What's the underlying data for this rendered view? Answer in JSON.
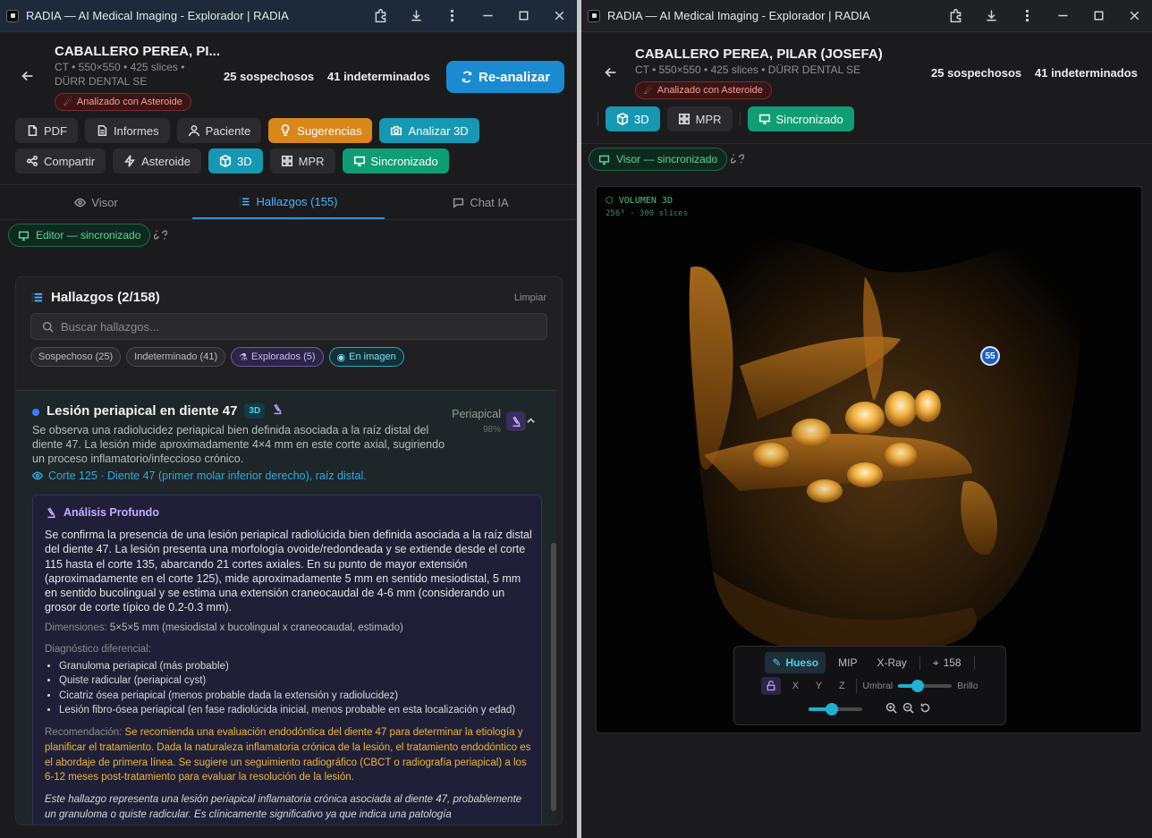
{
  "left": {
    "window_title": "RADIA — AI Medical Imaging - Explorador | RADIA",
    "patient": {
      "name": "CABALLERO PEREA, PI...",
      "meta_line1": "CT • 550×550 • 425 slices •",
      "meta_line2": "DÜRR DENTAL SE",
      "badge": "Analizado con Asteroide"
    },
    "stats": {
      "suspicious": "25 sospechosos",
      "indeterminate": "41 indeterminados"
    },
    "reanalyze": "Re-analizar",
    "toolbar1": [
      "PDF",
      "Informes",
      "Paciente",
      "Sugerencias",
      "Analizar 3D"
    ],
    "toolbar2": [
      "Compartir",
      "Asteroide",
      "3D",
      "MPR",
      "Sincronizado"
    ],
    "tabs": [
      "Visor",
      "Hallazgos (155)",
      "Chat IA"
    ],
    "sync": "Editor — sincronizado",
    "panel": {
      "title": "Hallazgos (2/158)",
      "clear": "Limpiar",
      "search_placeholder": "Buscar hallazgos...",
      "chips": [
        "Sospechoso (25)",
        "Indeterminado (41)",
        "Explorados (5)",
        "En imagen"
      ]
    },
    "finding": {
      "title": "Lesión periapical en diente 47",
      "tag": "3D",
      "type": "Periapical",
      "confidence": "98%",
      "description": "Se observa una radiolucidez periapical bien definida asociada a la raíz distal del diente 47. La lesión mide aproximadamente 4×4 mm en este corte axial, sugiriendo un proceso inflamatorio/infeccioso crónico.",
      "slice": "Corte 125 · Diente 47 (primer molar inferior derecho), raíz distal.",
      "deep": {
        "heading": "Análisis Profundo",
        "body": "Se confirma la presencia de una lesión periapical radiolúcida bien definida asociada a la raíz distal del diente 47. La lesión presenta una morfología ovoide/redondeada y se extiende desde el corte 115 hasta el corte 135, abarcando 21 cortes axiales. En su punto de mayor extensión (aproximadamente en el corte 125), mide aproximadamente 5 mm en sentido mesiodistal, 5 mm en sentido bucolingual y se estima una extensión craneocaudal de 4-6 mm (considerando un grosor de corte típico de 0.2-0.3 mm).",
        "dim_label": "Dimensiones:",
        "dim_value": "5×5×5 mm (mesiodistal x bucolingual x craneocaudal, estimado)",
        "diff_label": "Diagnóstico diferencial:",
        "diff": [
          "Granuloma periapical (más probable)",
          "Quiste radicular (periapical cyst)",
          "Cicatriz ósea periapical (menos probable dada la extensión y radiolucidez)",
          "Lesión fibro-ósea periapical (en fase radiolúcida inicial, menos probable en esta localización y edad)"
        ],
        "rec_label": "Recomendación:",
        "rec": "Se recomienda una evaluación endodóntica del diente 47 para determinar la etiología y planificar el tratamiento. Dada la naturaleza inflamatoria crónica de la lesión, el tratamiento endodóntico es el abordaje de primera línea. Se sugiere un seguimiento radiográfico (CBCT o radiografía periapical) a los 6-12 meses post-tratamiento para evaluar la resolución de la lesión.",
        "summary": "Este hallazgo representa una lesión periapical inflamatoria crónica asociada al diente 47, probablemente un granuloma o quiste radicular. Es clínicamente significativo ya que indica una patología"
      }
    }
  },
  "right": {
    "window_title": "RADIA — AI Medical Imaging - Explorador | RADIA",
    "patient": {
      "name": "CABALLERO PEREA, PILAR (JOSEFA)",
      "meta": "CT • 550×550 • 425 slices • DÜRR DENTAL SE",
      "badge": "Analizado con Asteroide"
    },
    "stats": {
      "suspicious": "25 sospechosos",
      "indeterminate": "41 indeterminados"
    },
    "toolbar": [
      "3D",
      "MPR",
      "Sincronizado"
    ],
    "sync": "Visor — sincronizado",
    "viewer": {
      "label": "VOLUMEN 3D",
      "sublabel": "256³ · 300 slices",
      "marker": "55",
      "modes": [
        "Hueso",
        "MIP",
        "X-Ray"
      ],
      "points": "158",
      "axes": [
        "X",
        "Y",
        "Z"
      ],
      "threshold": "Umbral",
      "brightness": "Brillo"
    }
  }
}
